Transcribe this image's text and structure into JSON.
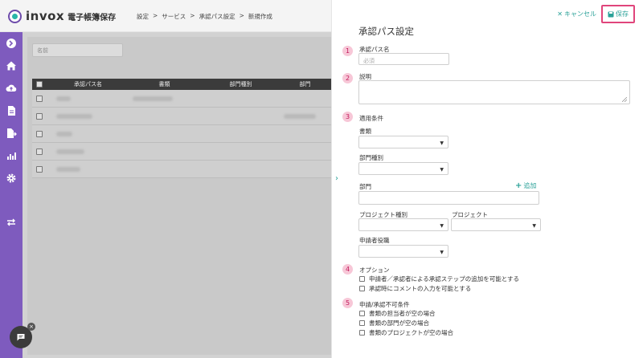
{
  "header": {
    "brand": "invox",
    "brand_sub": "電子帳簿保存",
    "breadcrumb": [
      "設定",
      ">",
      "サービス",
      ">",
      "承認パス設定",
      ">",
      "新規作成"
    ]
  },
  "sidebar": {
    "icons": [
      "arrow-right-circle-icon",
      "home-icon",
      "cloud-upload-icon",
      "document-icon",
      "document-export-icon",
      "chart-icon",
      "gear-icon",
      "transfer-icon"
    ]
  },
  "list": {
    "filter_placeholder": "名前",
    "columns": [
      "承認パス名",
      "書類",
      "部門種別",
      "部門"
    ],
    "row_count": 5
  },
  "panel": {
    "cancel_label": "キャンセル",
    "save_label": "保存",
    "title": "承認パス設定",
    "sections": {
      "s1_num": "1",
      "s1_label": "承認パス名",
      "s1_placeholder": "必須",
      "s2_num": "2",
      "s2_label": "説明",
      "s3_num": "3",
      "s3_label": "適用条件",
      "document_label": "書類",
      "dept_type_label": "部門種別",
      "dept_label": "部門",
      "add_label": "追加",
      "project_type_label": "プロジェクト種別",
      "project_label": "プロジェクト",
      "applicant_role_label": "申請者役職",
      "s4_num": "4",
      "s4_label": "オプション",
      "option1": "申請者／承認者による承認ステップの追加を可能とする",
      "option2": "承認時にコメントの入力を可能とする",
      "s5_num": "5",
      "s5_label": "申請/承認不可条件",
      "cond1": "書類の担当者が空の場合",
      "cond2": "書類の部門が空の場合",
      "cond3": "書類のプロジェクトが空の場合"
    }
  },
  "colors": {
    "sidebar": "#7e5bbe",
    "accent": "#2aa198",
    "highlight": "#e0457b",
    "badge_bg": "#f7c7d7"
  }
}
